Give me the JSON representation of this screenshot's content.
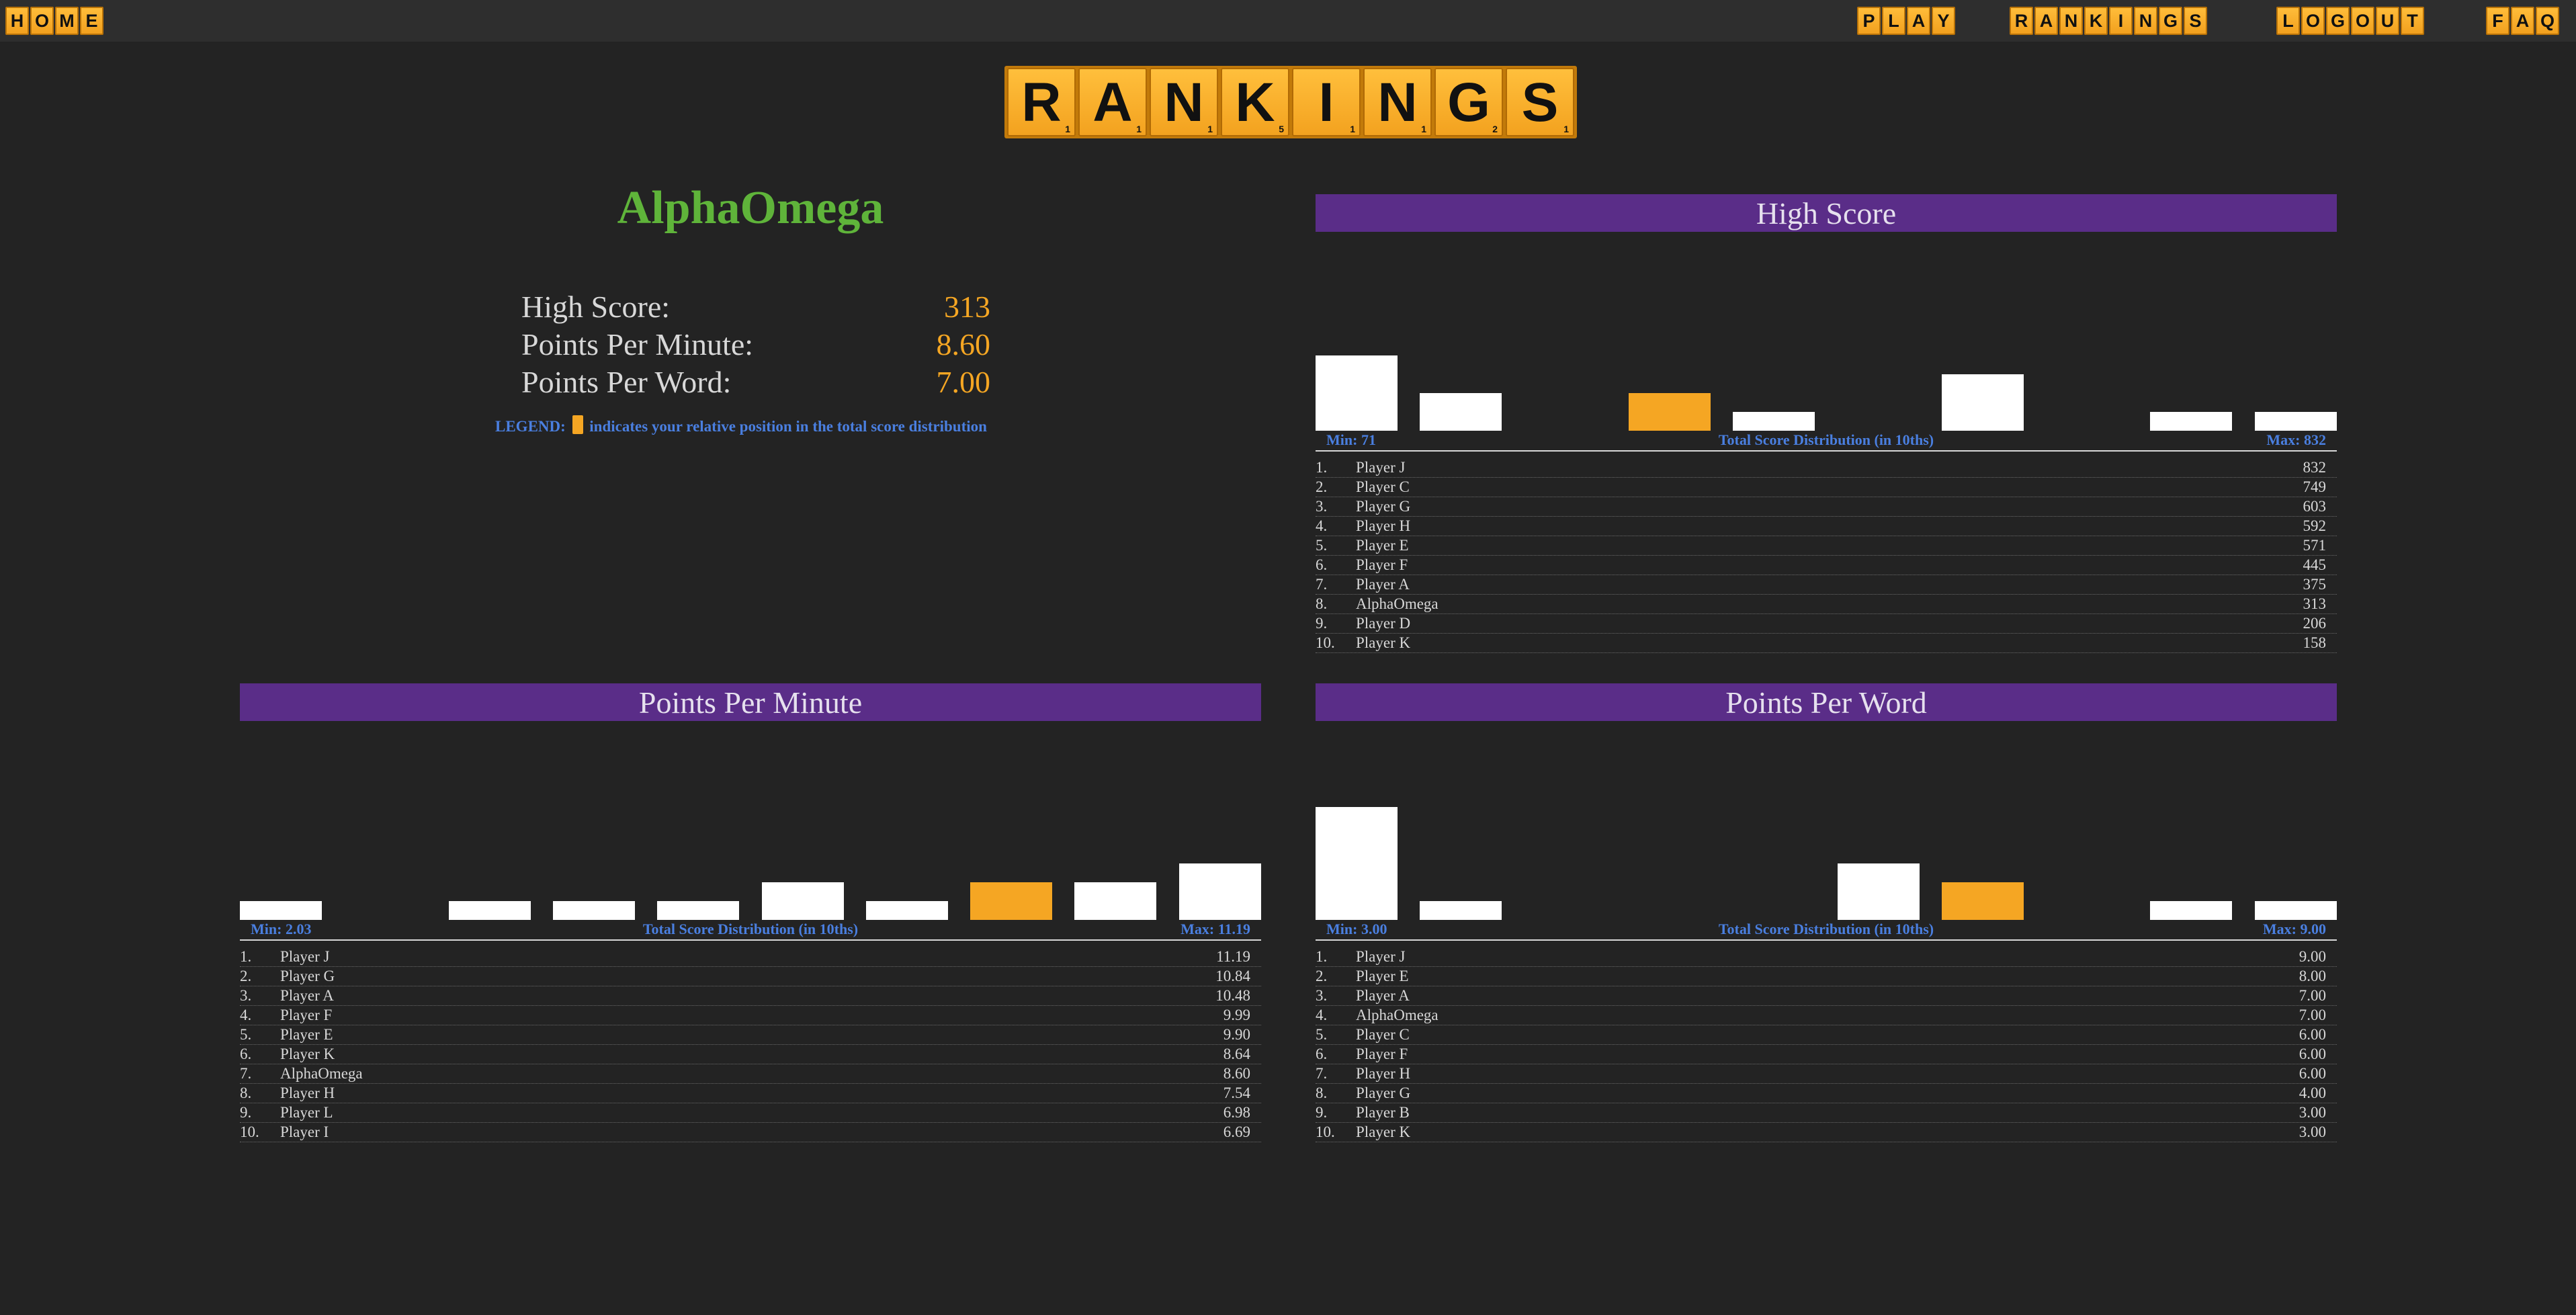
{
  "nav": {
    "home": "HOME",
    "play": "PLAY",
    "rankings": "RANKINGS",
    "logout": "LOGOUT",
    "faq": "FAQ"
  },
  "title_tiles": [
    {
      "letter": "R",
      "score": "1"
    },
    {
      "letter": "A",
      "score": "1"
    },
    {
      "letter": "N",
      "score": "1"
    },
    {
      "letter": "K",
      "score": "5"
    },
    {
      "letter": "I",
      "score": "1"
    },
    {
      "letter": "N",
      "score": "1"
    },
    {
      "letter": "G",
      "score": "2"
    },
    {
      "letter": "S",
      "score": "1"
    }
  ],
  "profile": {
    "username": "AlphaOmega",
    "stats": [
      {
        "label": "High Score:",
        "value": "313"
      },
      {
        "label": "Points Per Minute:",
        "value": "8.60"
      },
      {
        "label": "Points Per Word:",
        "value": "7.00"
      }
    ],
    "legend_prefix": "LEGEND:",
    "legend_text": "indicates your relative position in the total score distribution"
  },
  "colors": {
    "accent_orange": "#f5a623",
    "header_purple": "#5a2d88",
    "username_green": "#5fb43a",
    "axis_blue": "#4a7fe0",
    "background": "#232323"
  },
  "panels": {
    "high_score": {
      "title": "High Score",
      "min_label": "Min: 71",
      "axis_label": "Total Score Distribution (in 10ths)",
      "max_label": "Max: 832",
      "distribution": [
        4,
        2,
        0,
        2,
        1,
        0,
        3,
        0,
        1,
        1
      ],
      "highlight_bin": 3,
      "rows": [
        {
          "rank": "1.",
          "name": "Player J",
          "score": "832"
        },
        {
          "rank": "2.",
          "name": "Player C",
          "score": "749"
        },
        {
          "rank": "3.",
          "name": "Player G",
          "score": "603"
        },
        {
          "rank": "4.",
          "name": "Player H",
          "score": "592"
        },
        {
          "rank": "5.",
          "name": "Player E",
          "score": "571"
        },
        {
          "rank": "6.",
          "name": "Player F",
          "score": "445"
        },
        {
          "rank": "7.",
          "name": "Player A",
          "score": "375"
        },
        {
          "rank": "8.",
          "name": "AlphaOmega",
          "score": "313"
        },
        {
          "rank": "9.",
          "name": "Player D",
          "score": "206"
        },
        {
          "rank": "10.",
          "name": "Player K",
          "score": "158"
        }
      ]
    },
    "ppm": {
      "title": "Points Per Minute",
      "min_label": "Min: 2.03",
      "axis_label": "Total Score Distribution (in 10ths)",
      "max_label": "Max: 11.19",
      "distribution": [
        1,
        0,
        1,
        1,
        1,
        2,
        1,
        2,
        2,
        3
      ],
      "highlight_bin": 7,
      "rows": [
        {
          "rank": "1.",
          "name": "Player J",
          "score": "11.19"
        },
        {
          "rank": "2.",
          "name": "Player G",
          "score": "10.84"
        },
        {
          "rank": "3.",
          "name": "Player A",
          "score": "10.48"
        },
        {
          "rank": "4.",
          "name": "Player F",
          "score": "9.99"
        },
        {
          "rank": "5.",
          "name": "Player E",
          "score": "9.90"
        },
        {
          "rank": "6.",
          "name": "Player K",
          "score": "8.64"
        },
        {
          "rank": "7.",
          "name": "AlphaOmega",
          "score": "8.60"
        },
        {
          "rank": "8.",
          "name": "Player H",
          "score": "7.54"
        },
        {
          "rank": "9.",
          "name": "Player L",
          "score": "6.98"
        },
        {
          "rank": "10.",
          "name": "Player I",
          "score": "6.69"
        }
      ]
    },
    "ppw": {
      "title": "Points Per Word",
      "min_label": "Min: 3.00",
      "axis_label": "Total Score Distribution (in 10ths)",
      "max_label": "Max: 9.00",
      "distribution": [
        6,
        1,
        0,
        0,
        0,
        3,
        2,
        0,
        1,
        1
      ],
      "highlight_bin": 6,
      "rows": [
        {
          "rank": "1.",
          "name": "Player J",
          "score": "9.00"
        },
        {
          "rank": "2.",
          "name": "Player E",
          "score": "8.00"
        },
        {
          "rank": "3.",
          "name": "Player A",
          "score": "7.00"
        },
        {
          "rank": "4.",
          "name": "AlphaOmega",
          "score": "7.00"
        },
        {
          "rank": "5.",
          "name": "Player C",
          "score": "6.00"
        },
        {
          "rank": "6.",
          "name": "Player F",
          "score": "6.00"
        },
        {
          "rank": "7.",
          "name": "Player H",
          "score": "6.00"
        },
        {
          "rank": "8.",
          "name": "Player G",
          "score": "4.00"
        },
        {
          "rank": "9.",
          "name": "Player B",
          "score": "3.00"
        },
        {
          "rank": "10.",
          "name": "Player K",
          "score": "3.00"
        }
      ]
    }
  }
}
